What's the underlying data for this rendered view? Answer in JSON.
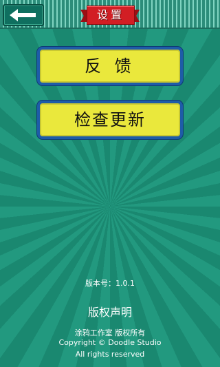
{
  "header": {
    "title": "设置",
    "back_icon": "arrow-left-icon"
  },
  "buttons": {
    "feedback": "反 馈",
    "check_update": "检查更新"
  },
  "footer": {
    "version": "版本号：1.0.1",
    "copyright_title": "版权声明",
    "studio_line": "涂鸦工作室 版权所有",
    "copyright_line": "Copyright © Doodle Studio",
    "rights_line": "All rights reserved"
  },
  "colors": {
    "background": "#1f9178",
    "button_fill": "#eae83c",
    "button_border": "#1e5ca8",
    "ribbon": "#d21e24"
  }
}
